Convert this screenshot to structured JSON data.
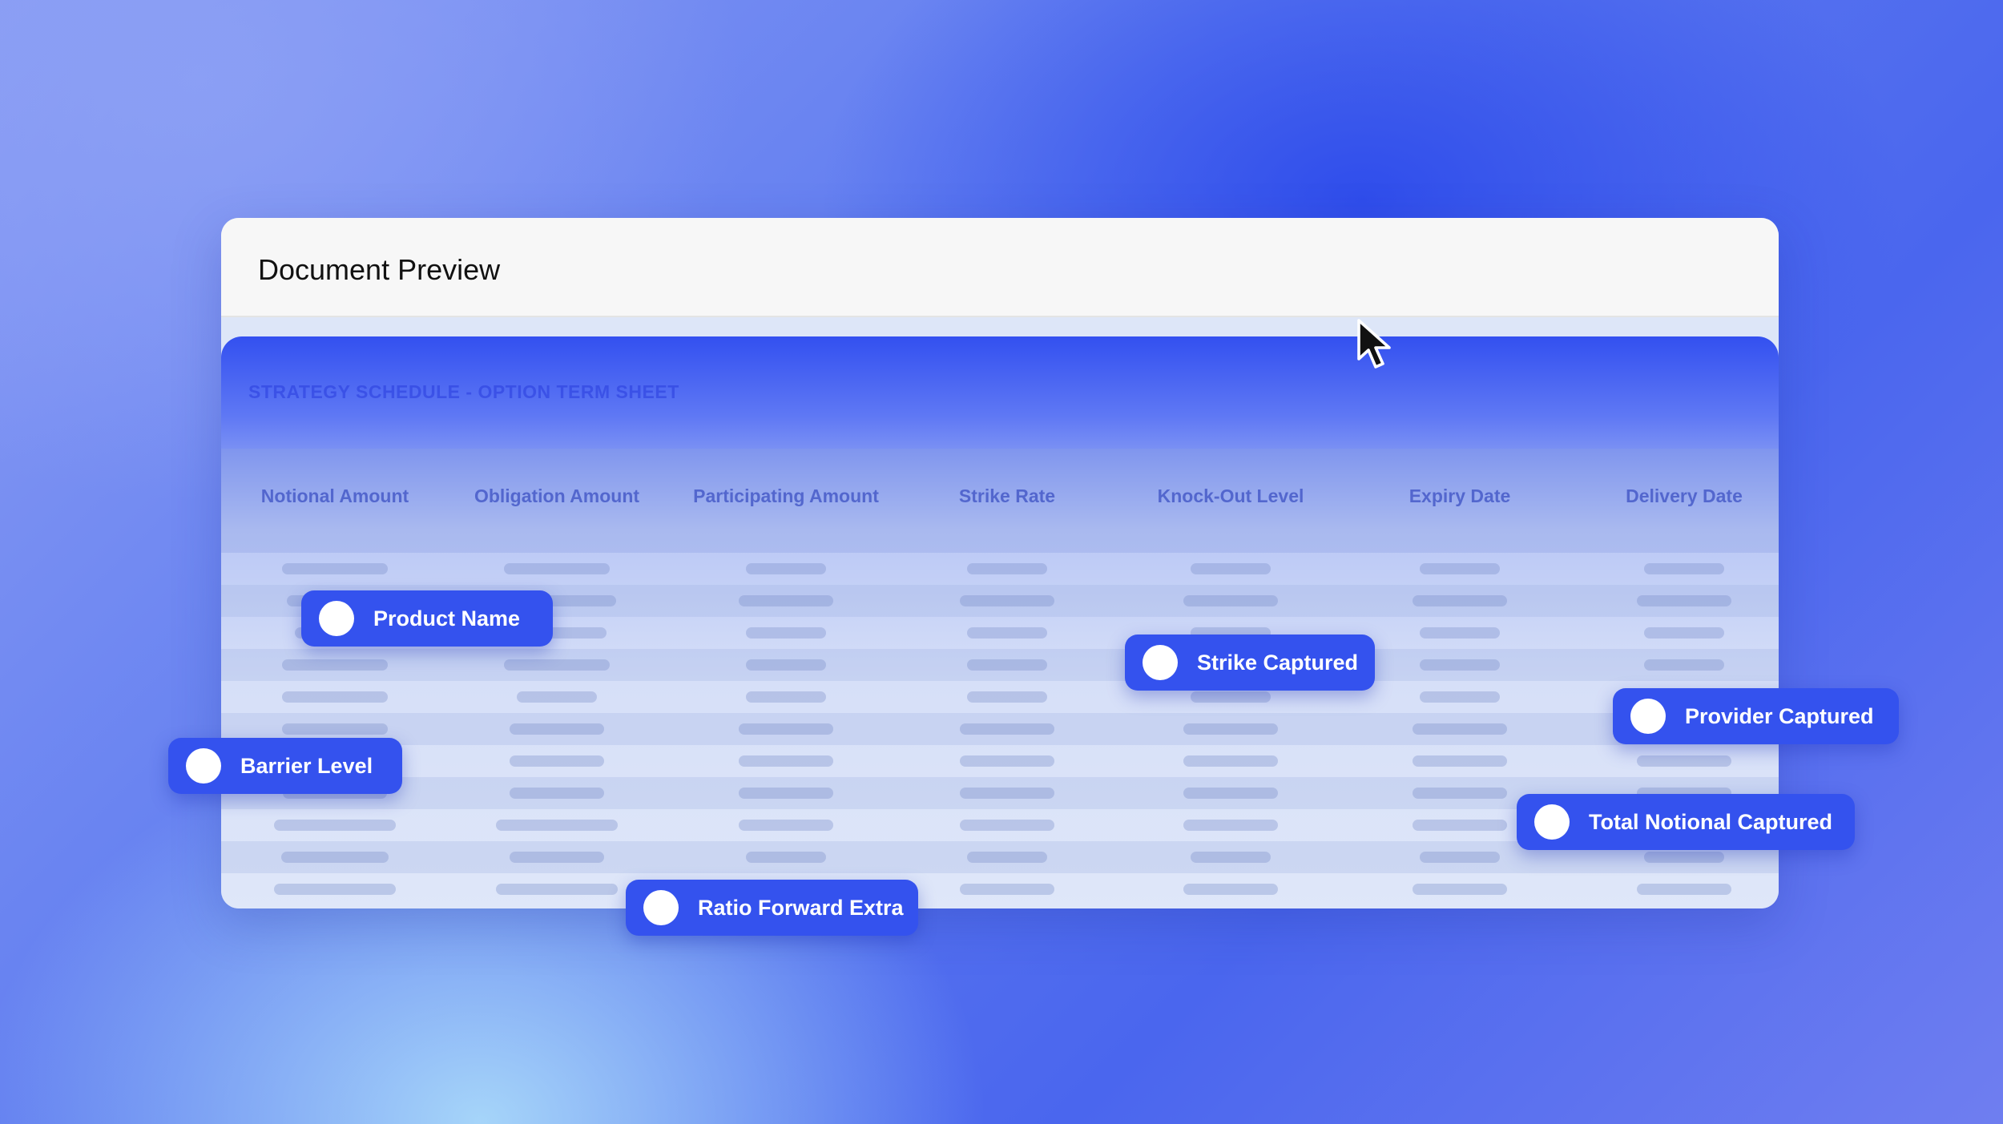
{
  "window": {
    "title": "Document Preview"
  },
  "document": {
    "title": "STRATEGY SCHEDULE - OPTION TERM SHEET",
    "columns": [
      "Notional Amount",
      "Obligation Amount",
      "Participating Amount",
      "Strike Rate",
      "Knock-Out Level",
      "Expiry Date",
      "Delivery Date"
    ]
  },
  "tags": [
    {
      "label": "Product Name"
    },
    {
      "label": "Strike Captured"
    },
    {
      "label": "Provider Captured"
    },
    {
      "label": "Barrier Level"
    },
    {
      "label": "Total Notional Captured"
    },
    {
      "label": "Ratio Forward Extra"
    }
  ],
  "icons": {
    "cursor": "mouse-pointer-icon",
    "tag_marker": "circle-marker-icon"
  },
  "colors": {
    "accent": "#3452ee",
    "tag_text": "#ffffff"
  }
}
